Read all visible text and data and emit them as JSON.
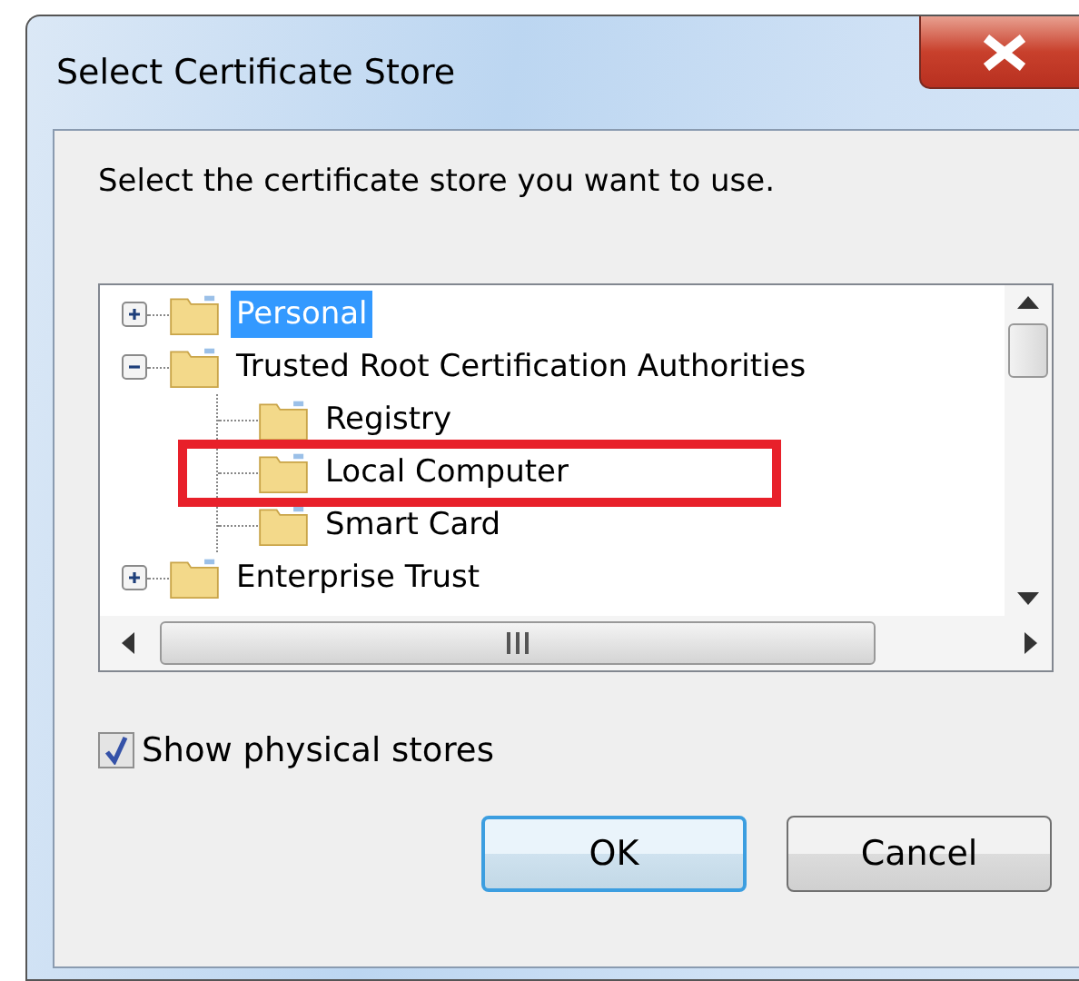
{
  "window": {
    "title": "Select Certificate Store"
  },
  "instruction": "Select the certificate store you want to use.",
  "tree": [
    {
      "label": "Personal",
      "selected": true,
      "expanded": false
    },
    {
      "label": "Trusted Root Certification Authorities",
      "selected": false,
      "expanded": true,
      "children": [
        {
          "label": "Registry",
          "selected": false,
          "highlighted": false
        },
        {
          "label": "Local Computer",
          "selected": false,
          "highlighted": true
        },
        {
          "label": "Smart Card",
          "selected": false,
          "highlighted": false
        }
      ]
    },
    {
      "label": "Enterprise Trust",
      "selected": false,
      "expanded": false
    }
  ],
  "show_physical": {
    "label": "Show physical stores",
    "checked": true
  },
  "buttons": [
    {
      "label": "OK",
      "default": true
    },
    {
      "label": "Cancel",
      "default": false
    }
  ]
}
